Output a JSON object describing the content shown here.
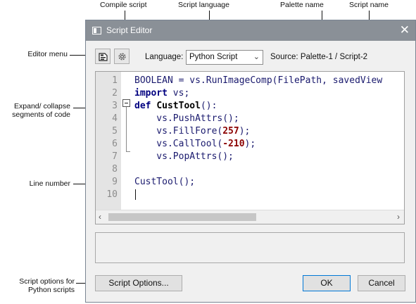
{
  "annotations": {
    "compile_script": "Compile script",
    "script_language": "Script language",
    "palette_name": "Palette name",
    "script_name": "Script name",
    "editor_menu": "Editor menu",
    "expand_collapse_1": "Expand/ collapse",
    "expand_collapse_2": "segments of code",
    "line_number": "Line number",
    "script_options_1": "Script options for",
    "script_options_2": "Python scripts"
  },
  "window": {
    "title": "Script Editor",
    "close_glyph": "✕"
  },
  "toolbar": {
    "language_label": "Language:",
    "language_value": "Python Script",
    "source_text": "Source: Palette-1 / Script-2"
  },
  "editor": {
    "line_numbers": [
      "1",
      "2",
      "3",
      "4",
      "5",
      "6",
      "7",
      "8",
      "9",
      "10"
    ],
    "lines": {
      "l1": "BOOLEAN = vs.RunImageComp(FilePath, savedView",
      "l2_kw": "import",
      "l2_rest": " vs;",
      "l3_kw": "def",
      "l3_fn": "CustTool",
      "l3_rest": "():",
      "l4": "    vs.PushAttrs();",
      "l5_pre": "    vs.FillFore(",
      "l5_num": "257",
      "l5_post": ");",
      "l6_pre": "    vs.CallTool(",
      "l6_num": "-210",
      "l6_post": ");",
      "l7": "    vs.PopAttrs();",
      "l9": "CustTool();"
    }
  },
  "buttons": {
    "script_options": "Script Options...",
    "ok": "OK",
    "cancel": "Cancel"
  },
  "colors": {
    "titlebar": "#8a9097",
    "keyword": "#000080",
    "number": "#8b0000",
    "ok_border": "#0078d7"
  }
}
